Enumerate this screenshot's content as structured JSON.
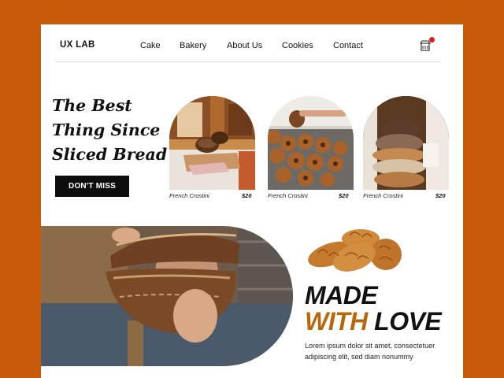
{
  "header": {
    "brand": "UX LAB",
    "nav": [
      "Cake",
      "Bakery",
      "About Us",
      "Cookies",
      "Contact"
    ],
    "cart_icon": "shop-cart-icon"
  },
  "hero": {
    "title_lines": [
      "The Best",
      "Thing Since",
      "Sliced Bread"
    ],
    "cta_label": "DON'T MISS"
  },
  "products": [
    {
      "name": "French Crostini",
      "price": "$20"
    },
    {
      "name": "French Crostini",
      "price": "$20"
    },
    {
      "name": "French Crostini",
      "price": "$20"
    }
  ],
  "feature": {
    "line1": "MADE",
    "line2_accent": "WITH",
    "line2_rest": "LOVE",
    "body": "Lorem ipsum dolor sit amet, consectetuer adipiscing elit, sed diam nonummy"
  },
  "colors": {
    "background": "#c75b0a",
    "accent": "#b8680a",
    "button": "#0d0d0d",
    "notification_dot": "#e11919"
  }
}
